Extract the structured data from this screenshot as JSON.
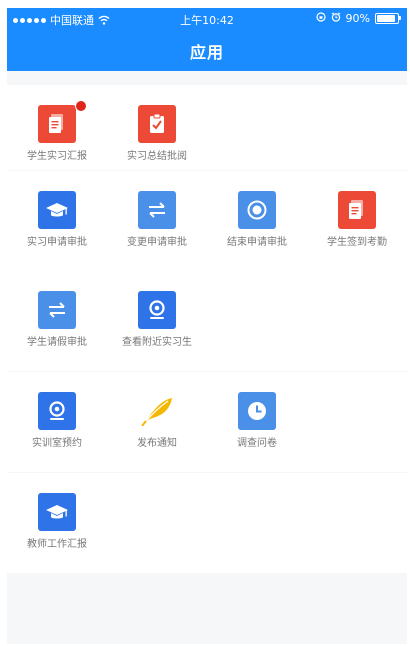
{
  "status_bar": {
    "carrier": "中国联通",
    "time": "上午10:42",
    "battery": "90%",
    "battery_level": 0.9
  },
  "header": {
    "title": "应用"
  },
  "colors": {
    "primary": "#1a8cff",
    "tile_red": "#ec4a36",
    "tile_blue": "#2f73e8",
    "tile_lightblue": "#4a90e8",
    "feather_yellow": "#f5b800",
    "badge_red": "#e0251b"
  },
  "sections": [
    {
      "apps": [
        {
          "label": "学生实习汇报",
          "icon": "document-icon",
          "badge": true
        },
        {
          "label": "实习总结批阅",
          "icon": "check-clipboard-icon",
          "badge": false
        }
      ]
    },
    {
      "apps": [
        {
          "label": "实习申请审批",
          "icon": "graduation-cap-icon"
        },
        {
          "label": "变更申请审批",
          "icon": "swap-arrows-icon"
        },
        {
          "label": "结束申请审批",
          "icon": "target-icon"
        },
        {
          "label": "学生签到考勤",
          "icon": "document-icon"
        },
        {
          "label": "学生请假审批",
          "icon": "swap-arrows-icon"
        },
        {
          "label": "查看附近实习生",
          "icon": "location-pin-icon"
        }
      ]
    },
    {
      "apps": [
        {
          "label": "实训室预约",
          "icon": "location-pin-icon"
        },
        {
          "label": "发布通知",
          "icon": "feather-icon"
        },
        {
          "label": "调查问卷",
          "icon": "clock-icon"
        }
      ]
    },
    {
      "apps": [
        {
          "label": "教师工作汇报",
          "icon": "graduation-cap-icon"
        }
      ]
    }
  ]
}
